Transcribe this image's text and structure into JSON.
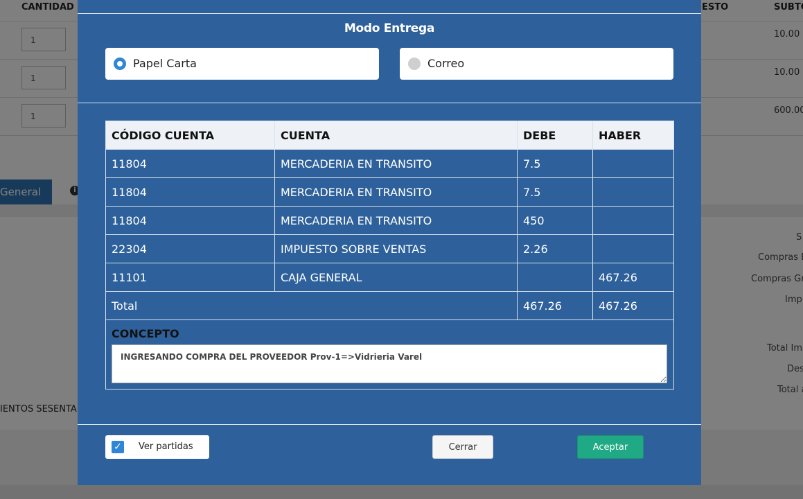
{
  "background": {
    "headers": {
      "quantity": "CANTIDAD",
      "discount_partial": "ESTO",
      "subtotal_partial": "SUBTO"
    },
    "rows": [
      {
        "qty": "1",
        "subtotal": "10.00"
      },
      {
        "qty": "1",
        "subtotal": "10.00"
      },
      {
        "qty": "1",
        "subtotal": "600.00"
      }
    ],
    "tab_label": "General",
    "info_icon": "i",
    "summary_labels": [
      "S",
      "Compras E",
      "Compras Gr",
      "Imp",
      "Total Imp",
      "Des",
      "Total a"
    ],
    "amount_words": "IENTOS SESENTA"
  },
  "modal": {
    "title": "Modo Entrega",
    "delivery_options": [
      {
        "label": "Papel Carta",
        "selected": true
      },
      {
        "label": "Correo",
        "selected": false
      }
    ],
    "table": {
      "headers": [
        "CÓDIGO CUENTA",
        "CUENTA",
        "DEBE",
        "HABER"
      ],
      "rows": [
        {
          "code": "11804",
          "account": "MERCADERIA EN TRANSITO",
          "debit": "7.5",
          "credit": ""
        },
        {
          "code": "11804",
          "account": "MERCADERIA EN TRANSITO",
          "debit": "7.5",
          "credit": ""
        },
        {
          "code": "11804",
          "account": "MERCADERIA EN TRANSITO",
          "debit": "450",
          "credit": ""
        },
        {
          "code": "22304",
          "account": "IMPUESTO SOBRE VENTAS",
          "debit": "2.26",
          "credit": ""
        },
        {
          "code": "11101",
          "account": "CAJA GENERAL",
          "debit": "",
          "credit": "467.26"
        }
      ],
      "total": {
        "label": "Total",
        "debit": "467.26",
        "credit": "467.26"
      },
      "concept_label": "CONCEPTO",
      "concept_value": "INGRESANDO COMPRA DEL PROVEEDOR Prov-1=>Vidrieria Varel"
    },
    "footer": {
      "checkbox_label": "Ver partidas",
      "checkbox_checked": true,
      "close_label": "Cerrar",
      "accept_label": "Aceptar"
    }
  },
  "colors": {
    "modal_bg": "#2e619b",
    "radio_selected": "#2f86d6",
    "accept_button": "#1fa984"
  }
}
